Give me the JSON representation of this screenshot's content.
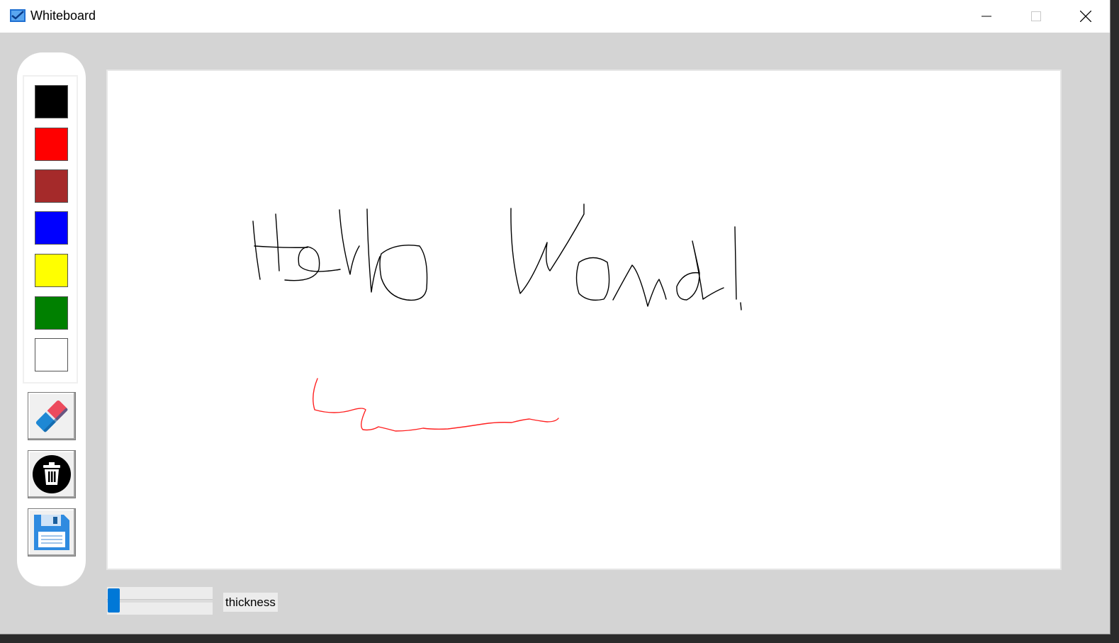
{
  "window": {
    "title": "Whiteboard",
    "controls": [
      "minimize",
      "maximize",
      "close"
    ]
  },
  "palette": {
    "colors": [
      {
        "name": "black",
        "hex": "#000000"
      },
      {
        "name": "red",
        "hex": "#ff0000"
      },
      {
        "name": "brown",
        "hex": "#a52a2a"
      },
      {
        "name": "blue",
        "hex": "#0000ff"
      },
      {
        "name": "yellow",
        "hex": "#ffff00"
      },
      {
        "name": "green",
        "hex": "#008000"
      },
      {
        "name": "white",
        "hex": "#ffffff"
      }
    ]
  },
  "tools": [
    {
      "name": "eraser",
      "icon": "eraser-icon"
    },
    {
      "name": "clear",
      "icon": "trash-icon"
    },
    {
      "name": "save",
      "icon": "floppy-disk-icon"
    }
  ],
  "canvas": {
    "drawing": "handwritten 'Hello World!' in black and a red squiggle"
  },
  "thickness": {
    "label": "thickness",
    "value_fraction": 0.0
  }
}
